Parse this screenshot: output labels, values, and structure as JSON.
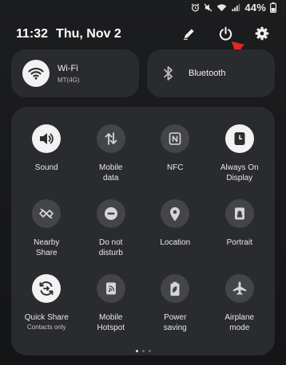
{
  "status_bar": {
    "battery_text": "44%",
    "icons": [
      "alarm-icon",
      "mute-icon",
      "wifi-icon",
      "signal-icon",
      "battery-icon"
    ]
  },
  "header": {
    "time": "11:32",
    "date": "Thu, Nov 2",
    "icons": [
      "edit-icon",
      "power-icon",
      "settings-icon"
    ]
  },
  "tiles": {
    "wifi": {
      "title": "Wi-Fi",
      "subtitle": "MT(4G)",
      "active": true
    },
    "bluetooth": {
      "title": "Bluetooth",
      "active": false
    }
  },
  "quick_settings": [
    {
      "label": "Sound",
      "icon": "volume-icon",
      "active": true
    },
    {
      "label": "Mobile\ndata",
      "icon": "mobile-data-icon",
      "active": false
    },
    {
      "label": "NFC",
      "icon": "nfc-icon",
      "active": false
    },
    {
      "label": "Always On\nDisplay",
      "icon": "always-on-display-icon",
      "active": true
    },
    {
      "label": "Nearby\nShare",
      "icon": "nearby-share-icon",
      "active": false
    },
    {
      "label": "Do not\ndisturb",
      "icon": "do-not-disturb-icon",
      "active": false
    },
    {
      "label": "Location",
      "icon": "location-icon",
      "active": false
    },
    {
      "label": "Portrait",
      "icon": "portrait-icon",
      "active": false
    },
    {
      "label": "Quick Share",
      "sub": "Contacts only",
      "icon": "quick-share-icon",
      "active": true
    },
    {
      "label": "Mobile\nHotspot",
      "icon": "hotspot-icon",
      "active": false
    },
    {
      "label": "Power\nsaving",
      "icon": "power-saving-icon",
      "active": false
    },
    {
      "label": "Airplane\nmode",
      "icon": "airplane-icon",
      "active": false
    }
  ],
  "page_indicator": {
    "pages": 3,
    "current": 1
  },
  "colors": {
    "active_fill": "#f2f2f2",
    "inactive_fill": "#43454a",
    "panel": "#2a2b2e",
    "annotation_arrow": "#e8261f"
  }
}
